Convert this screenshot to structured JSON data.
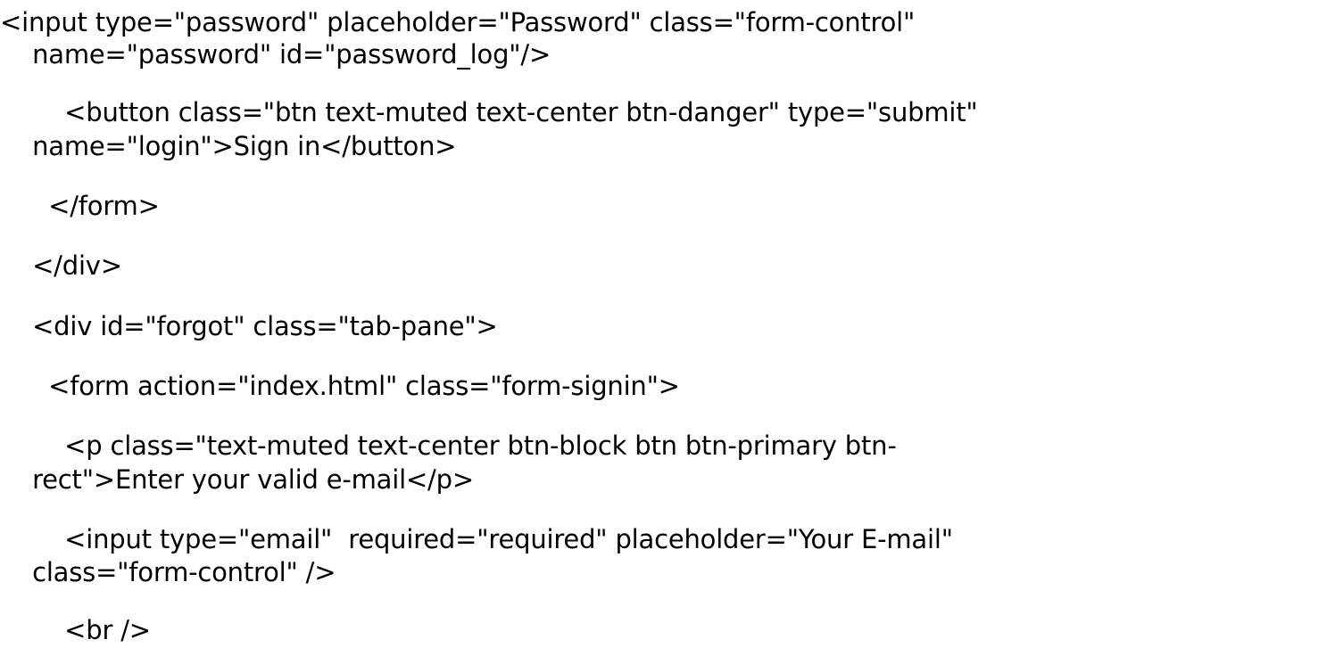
{
  "lines": [
    "<input type=\"password\" placeholder=\"Password\" class=\"form-control\"",
    "    name=\"password\" id=\"password_log\"/>",
    "        <button class=\"btn text-muted text-center btn-danger\" type=\"submit\"",
    "    name=\"login\">Sign in</button>",
    "      </form>",
    "    </div>",
    "    <div id=\"forgot\" class=\"tab-pane\">",
    "      <form action=\"index.html\" class=\"form-signin\">",
    "        <p class=\"text-muted text-center btn-block btn btn-primary btn-",
    "    rect\">Enter your valid e-mail</p>",
    "        <input type=\"email\"  required=\"required\" placeholder=\"Your E-mail\"",
    "    class=\"form-control\" />",
    "        <br />"
  ]
}
